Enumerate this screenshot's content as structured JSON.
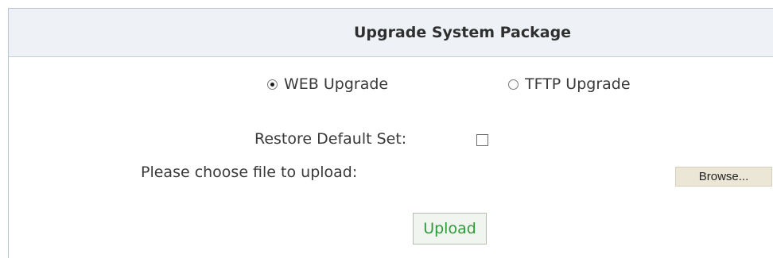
{
  "panel": {
    "title": "Upgrade System Package"
  },
  "upgrade_mode": {
    "options": [
      {
        "label": "WEB Upgrade",
        "selected": true
      },
      {
        "label": "TFTP Upgrade",
        "selected": false
      }
    ]
  },
  "restore_default": {
    "label": "Restore Default Set:",
    "checked": false
  },
  "file_upload": {
    "label": "Please choose file to upload:",
    "browse_label": "Browse..."
  },
  "actions": {
    "upload_label": "Upload"
  },
  "colors": {
    "header_bg": "#eef2f7",
    "border": "#b9c4cf",
    "upload_text": "#2e9a3a",
    "browse_bg": "#ece6d6"
  }
}
